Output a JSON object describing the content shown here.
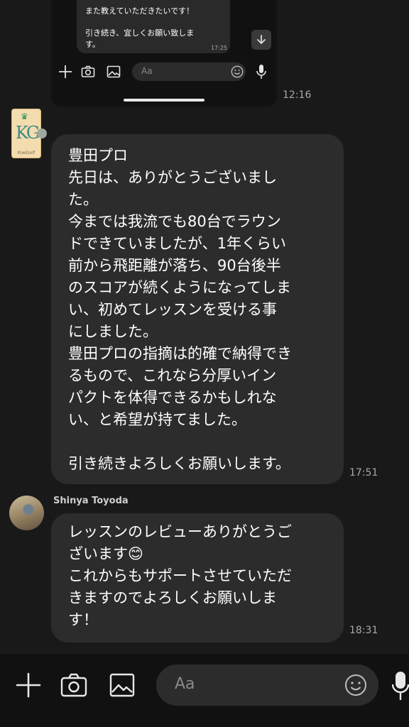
{
  "embedded_chat": {
    "lines": [
      "また教えていただきたいです！",
      "引き続き、宜しくお願い致しま",
      "す。"
    ],
    "time": "17:25",
    "input_placeholder": "Aa"
  },
  "messages": [
    {
      "time": "12:16"
    },
    {
      "lines": [
        "豊田プロ",
        "先日は、ありがとうございまし",
        "た。",
        "今までは我流でも80台でラウン",
        "ドできていましたが、1年くらい",
        "前から飛距離が落ち、90台後半",
        "のスコアが続くようになってしま",
        "い、初めてレッスンを受ける事",
        "にしました。",
        "豊田プロの指摘は的確で納得でき",
        "るもので、これなら分厚いイン",
        "パクトを体得できるかもしれな",
        "い、と希望が持てました。",
        "",
        "引き続きよろしくお願いします。"
      ],
      "time": "17:51",
      "avatar_brand": "KiwiGolf"
    },
    {
      "sender": "Shinya Toyoda",
      "lines": [
        "レッスンのレビューありがとうご",
        "ざいます😊",
        "これからもサポートさせていただ",
        "きますのでよろしくお願いしま",
        "す！"
      ],
      "time": "18:31"
    }
  ],
  "composer": {
    "placeholder": "Aa"
  },
  "icons": [
    "plus-icon",
    "camera-icon",
    "image-icon",
    "emoji-icon",
    "mic-icon",
    "arrow-down-icon",
    "crown-icon"
  ]
}
